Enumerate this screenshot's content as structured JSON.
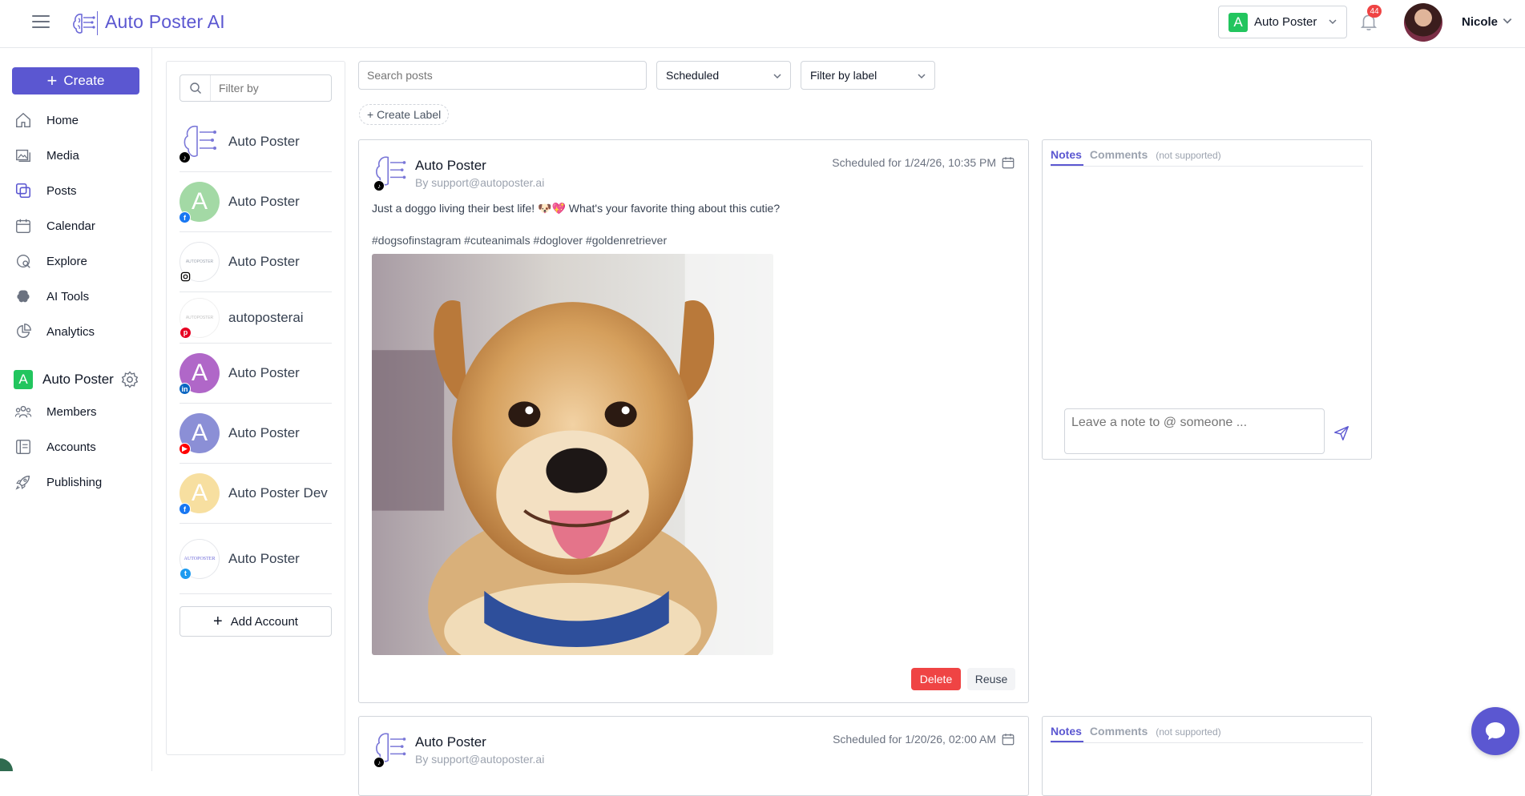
{
  "topbar": {
    "brand": "Auto Poster AI",
    "workspace_initial": "A",
    "workspace_label": "Auto Poster",
    "notification_count": "44",
    "user_name": "Nicole"
  },
  "nav": {
    "create_label": "Create",
    "items": [
      "Home",
      "Media",
      "Posts",
      "Calendar",
      "Explore",
      "AI Tools",
      "Analytics"
    ],
    "workspace_initial": "A",
    "workspace_name": "Auto Poster",
    "ws_items": [
      "Members",
      "Accounts",
      "Publishing"
    ]
  },
  "accounts": {
    "filter_placeholder": "Filter by",
    "items": [
      {
        "name": "Auto Poster",
        "network": "tiktok-icon",
        "avatar": "logo"
      },
      {
        "name": "Auto Poster",
        "network": "facebook-icon",
        "initial": "A",
        "color": "#a3d9a5"
      },
      {
        "name": "Auto Poster",
        "network": "instagram-icon",
        "avatar": "small-logo"
      },
      {
        "name": "autoposterai",
        "network": "pinterest-icon",
        "avatar": "small-logo"
      },
      {
        "name": "Auto Poster",
        "network": "linkedin-icon",
        "initial": "A",
        "color": "#b067c8"
      },
      {
        "name": "Auto Poster",
        "network": "youtube-icon",
        "initial": "A",
        "color": "#8b8fd6"
      },
      {
        "name": "Auto Poster Dev",
        "network": "facebook-icon",
        "initial": "A",
        "color": "#f7dfa0"
      },
      {
        "name": "Auto Poster",
        "network": "twitter-icon",
        "avatar": "wordmark"
      }
    ],
    "add_label": "Add Account"
  },
  "toolbar": {
    "search_placeholder": "Search posts",
    "status_value": "Scheduled",
    "label_filter_value": "Filter by label",
    "create_label": "+ Create Label"
  },
  "posts": [
    {
      "author": "Auto Poster",
      "by": "By support@autoposter.ai",
      "scheduled": "Scheduled for 1/24/26, 10:35 PM",
      "caption": "Just a doggo living their best life! 🐶💖 What's your favorite thing about this cutie?",
      "hashtags": "#dogsofinstagram #cuteanimals #doglover #goldenretriever",
      "delete_label": "Delete",
      "reuse_label": "Reuse"
    },
    {
      "author": "Auto Poster",
      "by": "By support@autoposter.ai",
      "scheduled": "Scheduled for 1/20/26, 02:00 AM"
    }
  ],
  "notes": {
    "tab_notes": "Notes",
    "tab_comments": "Comments",
    "tab_note": "(not supported)",
    "input_placeholder": "Leave a note to @ someone ..."
  },
  "colors": {
    "accent": "#5b57d1",
    "workspace_green": "#22c55e",
    "danger": "#ef4444"
  }
}
